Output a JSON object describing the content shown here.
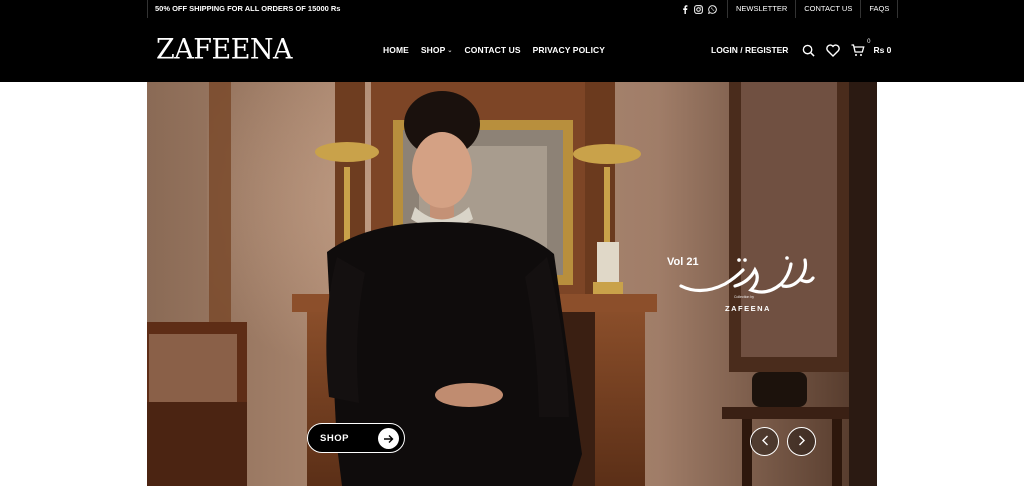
{
  "topbar": {
    "promo": "50% OFF SHIPPING FOR ALL ORDERS OF 15000 Rs",
    "social_icons": [
      "facebook-icon",
      "instagram-icon",
      "whatsapp-icon"
    ],
    "links": [
      "NEWSLETTER",
      "CONTACT US",
      "FAQS"
    ]
  },
  "header": {
    "logo": "ZAFEENA",
    "nav": {
      "home": "HOME",
      "shop": "SHOP",
      "contact": "CONTACT US",
      "privacy": "PRIVACY POLICY"
    },
    "login": "LOGIN / REGISTER",
    "cart_count": "0",
    "cart_amount": "Rs 0",
    "icons": [
      "search-icon",
      "heart-icon",
      "cart-icon"
    ]
  },
  "hero": {
    "volume": "Vol 21",
    "collection_by": "Collection by",
    "brand": "ZAFEENA",
    "shop_button": "SHOP",
    "icons": [
      "arrow-right-icon",
      "chevron-left-icon",
      "chevron-right-icon"
    ]
  },
  "colors": {
    "header_bg": "#000000",
    "text_light": "#ffffff"
  }
}
